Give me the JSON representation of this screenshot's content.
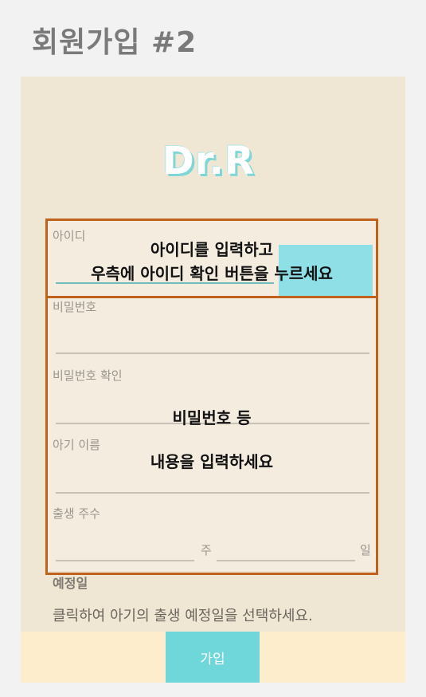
{
  "slide_title": "회원가입 #2",
  "app": {
    "logo_text": "Dr.R",
    "form": {
      "id_label": "아이디",
      "password_label": "비밀번호",
      "password_confirm_label": "비밀번호 확인",
      "baby_name_label": "아기 이름",
      "birth_week_label": "출생 주수",
      "week_suffix": "주",
      "day_suffix": "일",
      "due_date_label": "예정일",
      "due_date_hint": "클릭하여 아기의 출생 예정일을 선택하세요."
    },
    "join_button": "가입"
  },
  "annotations": {
    "id_note_line1": "아이디를 입력하고",
    "id_note_line2": "우측에 아이디 확인 버튼을 누르세요",
    "fields_note_line1": "비밀번호 등",
    "fields_note_line2": "내용을 입력하세요"
  },
  "colors": {
    "callout_border": "#c0611d",
    "accent_teal": "#6fd7da",
    "background": "#f0e6d4"
  }
}
